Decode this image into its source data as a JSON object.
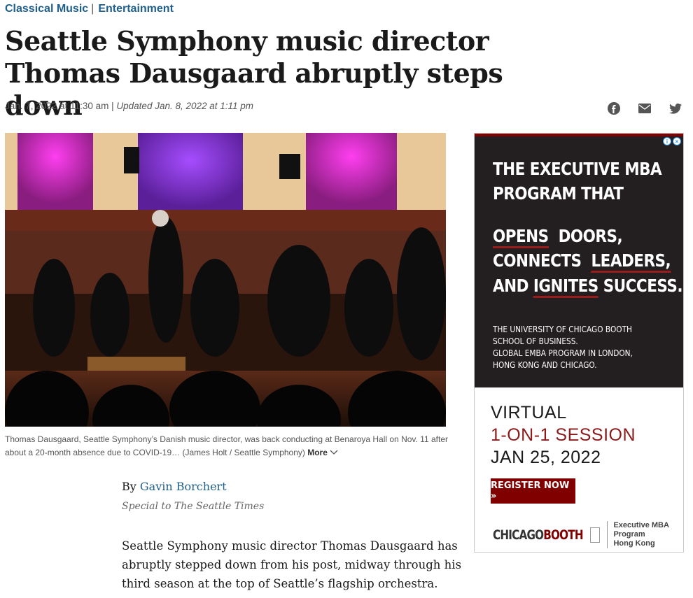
{
  "breadcrumbs": [
    "Classical Music",
    "Entertainment"
  ],
  "headline": "Seattle Symphony music director Thomas Dausgaard abruptly steps down",
  "dateline": {
    "published": "Jan. 7, 2022 at 11:30 am",
    "separator": "|",
    "updated": "Updated Jan. 8, 2022 at 1:11 pm"
  },
  "share_icons": [
    "facebook-icon",
    "email-icon",
    "twitter-icon"
  ],
  "photo": {
    "caption": "Thomas Dausgaard, Seattle Symphony’s Danish music director, was back conducting at Benaroya Hall on Nov. 11 after about a 20-month absence due to COVID-19… (James Holt / Seattle Symphony)",
    "more_label": "More"
  },
  "byline": {
    "prefix": "By",
    "author": "Gavin Borchert",
    "credit": "Special to The Seattle Times"
  },
  "body": "Seattle Symphony music director Thomas Dausgaard has abruptly stepped down from his post, midway through his third season at the top of Seattle’s flagship orchestra.",
  "ad": {
    "headline_line1": "THE EXECUTIVE MBA",
    "headline_line2": "PROGRAM THAT",
    "opens": "OPENS",
    "doors": "DOORS,",
    "connects": "CONNECTS",
    "leaders": "LEADERS,",
    "and": "AND",
    "ignites": "IGNITES",
    "success": "SUCCESS.",
    "school_line1": "THE UNIVERSITY OF CHICAGO BOOTH",
    "school_line2": "SCHOOL OF BUSINESS.",
    "school_line3": "GLOBAL EMBA PROGRAM IN LONDON,",
    "school_line4": "HONG KONG AND CHICAGO.",
    "virtual": "VIRTUAL",
    "session": "1-ON-1 SESSION",
    "date": "JAN 25, 2022",
    "cta": "REGISTER NOW »",
    "logo_part1": "CHICAGO",
    "logo_part2": "BOOTH",
    "tag_line1": "Executive MBA Program",
    "tag_line2": "Hong Kong"
  }
}
